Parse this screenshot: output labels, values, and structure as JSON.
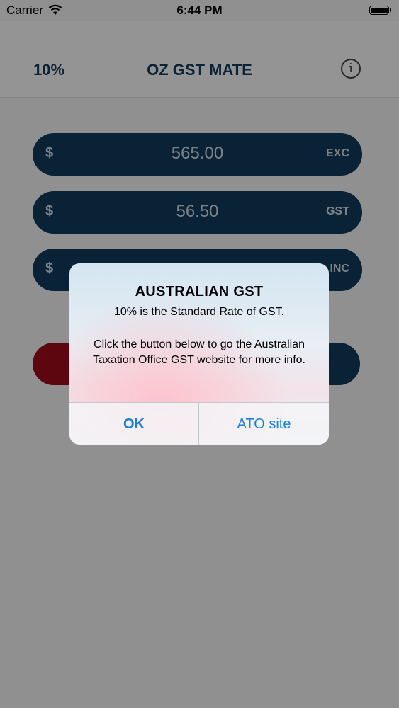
{
  "status_bar": {
    "carrier": "Carrier",
    "time": "6:44 PM",
    "wifi_icon": "wifi-icon",
    "battery_icon": "battery-icon"
  },
  "nav": {
    "rate": "10%",
    "title": "OZ GST MATE",
    "info_icon": "info-icon"
  },
  "fields": [
    {
      "currency": "$",
      "value": "565.00",
      "unit": "EXC"
    },
    {
      "currency": "$",
      "value": "56.50",
      "unit": "GST"
    },
    {
      "currency": "$",
      "value": "",
      "unit": "INC"
    }
  ],
  "alert": {
    "title": "AUSTRALIAN GST",
    "message_line1": "10% is the Standard Rate of GST.",
    "message_line2": "Click the button below to go the Australian Taxation Office GST website for more info.",
    "ok_label": "OK",
    "ato_label": "ATO site"
  },
  "colors": {
    "navy": "#0f3a5b",
    "red": "#9b0a1c",
    "link_blue": "#1a7fe0",
    "title_navy": "#143a5a"
  }
}
